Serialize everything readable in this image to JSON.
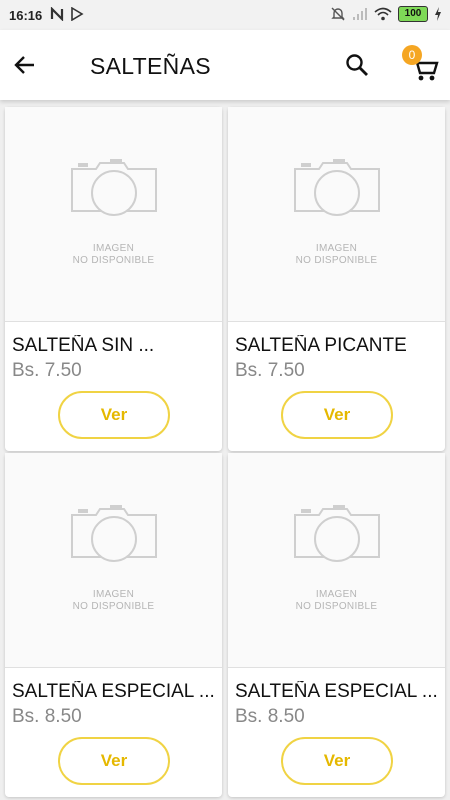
{
  "status_bar": {
    "time": "16:16",
    "battery": "100"
  },
  "app_bar": {
    "title": "SALTEÑAS",
    "cart_count": "0"
  },
  "placeholder": {
    "line1": "IMAGEN",
    "line2": "NO DISPONIBLE"
  },
  "products": [
    {
      "name": "SALTEÑA SIN ...",
      "price": "Bs. 7.50",
      "button": "Ver"
    },
    {
      "name": "SALTEÑA PICANTE",
      "price": "Bs. 7.50",
      "button": "Ver"
    },
    {
      "name": "SALTEÑA ESPECIAL ...",
      "price": "Bs. 8.50",
      "button": "Ver"
    },
    {
      "name": "SALTEÑA ESPECIAL ...",
      "price": "Bs. 8.50",
      "button": "Ver"
    }
  ],
  "colors": {
    "accent": "#f0d344",
    "badge": "#f5a623"
  }
}
